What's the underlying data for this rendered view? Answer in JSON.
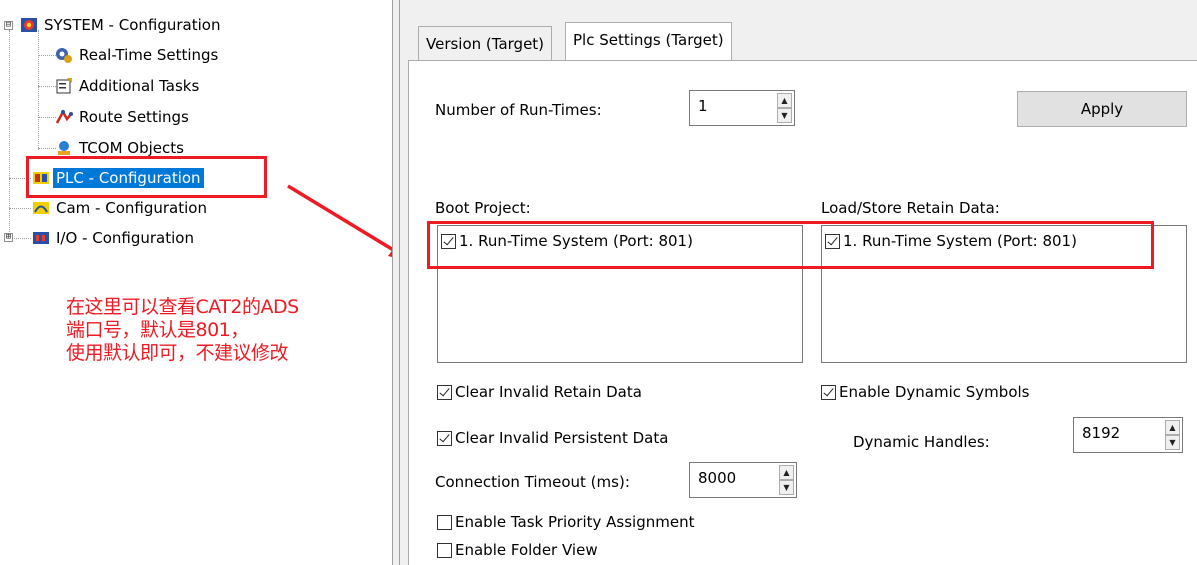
{
  "tree": {
    "items": [
      {
        "label": "SYSTEM - Configuration",
        "icon": "system-config-icon",
        "expander": "⊟"
      },
      {
        "label": "Real-Time Settings",
        "icon": "realtime-settings-icon"
      },
      {
        "label": "Additional Tasks",
        "icon": "additional-tasks-icon"
      },
      {
        "label": "Route Settings",
        "icon": "route-settings-icon"
      },
      {
        "label": "TCOM Objects",
        "icon": "tcom-objects-icon"
      },
      {
        "label": "PLC - Configuration",
        "icon": "plc-config-icon",
        "selected": true
      },
      {
        "label": "Cam - Configuration",
        "icon": "cam-config-icon"
      },
      {
        "label": "I/O - Configuration",
        "icon": "io-config-icon",
        "expander": "⊞"
      }
    ]
  },
  "annotation": {
    "lines": [
      "在这里可以查看CAT2的ADS",
      "端口号，默认是801，",
      "使用默认即可，不建议修改"
    ],
    "color": "#ee1b24"
  },
  "tabs": [
    {
      "label": "Version (Target)",
      "active": false
    },
    {
      "label": "Plc Settings (Target)",
      "active": true
    }
  ],
  "settings": {
    "runtimes_label": "Number of Run-Times:",
    "runtimes_value": "1",
    "apply_label": "Apply",
    "boot_project_label": "Boot Project:",
    "boot_project_item": "1. Run-Time System (Port: 801)",
    "retain_label": "Load/Store Retain Data:",
    "retain_item": "1. Run-Time System (Port: 801)",
    "clear_retain_label": "Clear Invalid Retain Data",
    "clear_persistent_label": "Clear Invalid Persistent Data",
    "enable_dynamic_symbols_label": "Enable Dynamic Symbols",
    "dynamic_handles_label": "Dynamic Handles:",
    "dynamic_handles_value": "8192",
    "connection_timeout_label": "Connection Timeout (ms):",
    "connection_timeout_value": "8000",
    "task_priority_label": "Enable Task Priority Assignment",
    "folder_view_label": "Enable Folder View"
  },
  "colors": {
    "highlight": "#ee1b24",
    "selection": "#0078d7"
  }
}
